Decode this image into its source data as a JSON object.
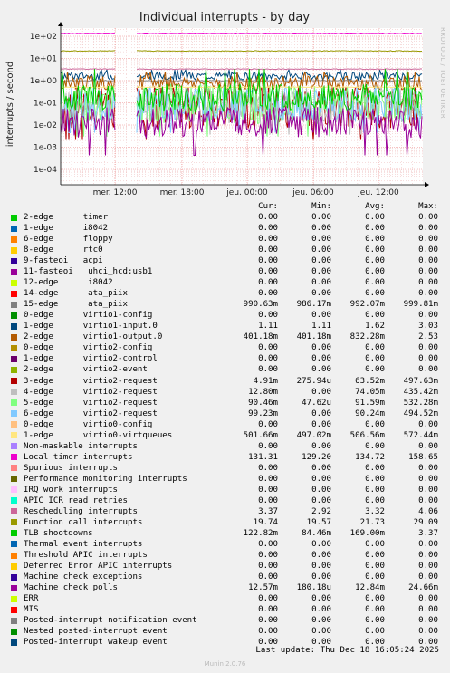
{
  "chart_data": {
    "type": "line",
    "title": "Individual interrupts - by day",
    "ylabel": "interrupts / second",
    "xlabel": "",
    "y_scale": "log",
    "ylim": [
      2e-05,
      300
    ],
    "y_ticks": [
      "1e+02",
      "1e+01",
      "1e+00",
      "1e-01",
      "1e-02",
      "1e-03",
      "1e-04"
    ],
    "x_ticks": [
      "mer. 12:00",
      "mer. 18:00",
      "jeu. 00:00",
      "jeu. 06:00",
      "jeu. 12:00"
    ],
    "grid": true,
    "side_label": "RRDTOOL / TOBI OETIKER",
    "data_gap": "around mer. 13:00",
    "legend_header": [
      "Cur:",
      "Min:",
      "Avg:",
      "Max:"
    ],
    "series": [
      {
        "name": "2-edge      timer",
        "color": "#00cc00",
        "cur": "0.00",
        "min": "0.00",
        "avg": "0.00",
        "max": "0.00"
      },
      {
        "name": "1-edge      i8042",
        "color": "#0066b3",
        "cur": "0.00",
        "min": "0.00",
        "avg": "0.00",
        "max": "0.00"
      },
      {
        "name": "6-edge      floppy",
        "color": "#ff8000",
        "cur": "0.00",
        "min": "0.00",
        "avg": "0.00",
        "max": "0.00"
      },
      {
        "name": "8-edge      rtc0",
        "color": "#ffcc00",
        "cur": "0.00",
        "min": "0.00",
        "avg": "0.00",
        "max": "0.00"
      },
      {
        "name": "9-fasteoi   acpi",
        "color": "#330099",
        "cur": "0.00",
        "min": "0.00",
        "avg": "0.00",
        "max": "0.00"
      },
      {
        "name": "11-fasteoi   uhci_hcd:usb1",
        "color": "#990099",
        "cur": "0.00",
        "min": "0.00",
        "avg": "0.00",
        "max": "0.00"
      },
      {
        "name": "12-edge      i8042",
        "color": "#ccff00",
        "cur": "0.00",
        "min": "0.00",
        "avg": "0.00",
        "max": "0.00"
      },
      {
        "name": "14-edge      ata_piix",
        "color": "#ff0000",
        "cur": "0.00",
        "min": "0.00",
        "avg": "0.00",
        "max": "0.00"
      },
      {
        "name": "15-edge      ata_piix",
        "color": "#808080",
        "cur": "990.63m",
        "min": "986.17m",
        "avg": "992.07m",
        "max": "999.81m"
      },
      {
        "name": "0-edge      virtio1-config",
        "color": "#008f00",
        "cur": "0.00",
        "min": "0.00",
        "avg": "0.00",
        "max": "0.00"
      },
      {
        "name": "1-edge      virtio1-input.0",
        "color": "#00487d",
        "cur": "1.11",
        "min": "1.11",
        "avg": "1.62",
        "max": "3.03"
      },
      {
        "name": "2-edge      virtio1-output.0",
        "color": "#b35a00",
        "cur": "401.18m",
        "min": "401.18m",
        "avg": "832.28m",
        "max": "2.53"
      },
      {
        "name": "0-edge      virtio2-config",
        "color": "#b38f00",
        "cur": "0.00",
        "min": "0.00",
        "avg": "0.00",
        "max": "0.00"
      },
      {
        "name": "1-edge      virtio2-control",
        "color": "#6b006b",
        "cur": "0.00",
        "min": "0.00",
        "avg": "0.00",
        "max": "0.00"
      },
      {
        "name": "2-edge      virtio2-event",
        "color": "#8fb300",
        "cur": "0.00",
        "min": "0.00",
        "avg": "0.00",
        "max": "0.00"
      },
      {
        "name": "3-edge      virtio2-request",
        "color": "#b30000",
        "cur": "4.91m",
        "min": "275.94u",
        "avg": "63.52m",
        "max": "497.63m"
      },
      {
        "name": "4-edge      virtio2-request",
        "color": "#bebebe",
        "cur": "12.80m",
        "min": "0.00",
        "avg": "74.05m",
        "max": "435.42m"
      },
      {
        "name": "5-edge      virtio2-request",
        "color": "#80ff80",
        "cur": "90.46m",
        "min": "47.62u",
        "avg": "91.59m",
        "max": "532.28m"
      },
      {
        "name": "6-edge      virtio2-request",
        "color": "#80c9ff",
        "cur": "99.23m",
        "min": "0.00",
        "avg": "90.24m",
        "max": "494.52m"
      },
      {
        "name": "0-edge      virtio0-config",
        "color": "#ffc080",
        "cur": "0.00",
        "min": "0.00",
        "avg": "0.00",
        "max": "0.00"
      },
      {
        "name": "1-edge      virtio0-virtqueues",
        "color": "#ffe680",
        "cur": "501.66m",
        "min": "497.02m",
        "avg": "506.56m",
        "max": "572.44m"
      },
      {
        "name": "Non-maskable interrupts",
        "color": "#aa80ff",
        "cur": "0.00",
        "min": "0.00",
        "avg": "0.00",
        "max": "0.00"
      },
      {
        "name": "Local timer interrupts",
        "color": "#ee00cc",
        "cur": "131.31",
        "min": "129.20",
        "avg": "134.72",
        "max": "158.65"
      },
      {
        "name": "Spurious interrupts",
        "color": "#ff8080",
        "cur": "0.00",
        "min": "0.00",
        "avg": "0.00",
        "max": "0.00"
      },
      {
        "name": "Performance monitoring interrupts",
        "color": "#666600",
        "cur": "0.00",
        "min": "0.00",
        "avg": "0.00",
        "max": "0.00"
      },
      {
        "name": "IRQ work interrupts",
        "color": "#ffbfff",
        "cur": "0.00",
        "min": "0.00",
        "avg": "0.00",
        "max": "0.00"
      },
      {
        "name": "APIC ICR read retries",
        "color": "#00ffcc",
        "cur": "0.00",
        "min": "0.00",
        "avg": "0.00",
        "max": "0.00"
      },
      {
        "name": "Rescheduling interrupts",
        "color": "#cc6699",
        "cur": "3.37",
        "min": "2.92",
        "avg": "3.32",
        "max": "4.06"
      },
      {
        "name": "Function call interrupts",
        "color": "#999900",
        "cur": "19.74",
        "min": "19.57",
        "avg": "21.73",
        "max": "29.09"
      },
      {
        "name": "TLB shootdowns",
        "color": "#00cc00",
        "cur": "122.82m",
        "min": "84.46m",
        "avg": "169.00m",
        "max": "3.37"
      },
      {
        "name": "Thermal event interrupts",
        "color": "#0066b3",
        "cur": "0.00",
        "min": "0.00",
        "avg": "0.00",
        "max": "0.00"
      },
      {
        "name": "Threshold APIC interrupts",
        "color": "#ff8000",
        "cur": "0.00",
        "min": "0.00",
        "avg": "0.00",
        "max": "0.00"
      },
      {
        "name": "Deferred Error APIC interrupts",
        "color": "#ffcc00",
        "cur": "0.00",
        "min": "0.00",
        "avg": "0.00",
        "max": "0.00"
      },
      {
        "name": "Machine check exceptions",
        "color": "#330099",
        "cur": "0.00",
        "min": "0.00",
        "avg": "0.00",
        "max": "0.00"
      },
      {
        "name": "Machine check polls",
        "color": "#990099",
        "cur": "12.57m",
        "min": "180.18u",
        "avg": "12.84m",
        "max": "24.66m"
      },
      {
        "name": "ERR",
        "color": "#ccff00",
        "cur": "0.00",
        "min": "0.00",
        "avg": "0.00",
        "max": "0.00"
      },
      {
        "name": "MIS",
        "color": "#ff0000",
        "cur": "0.00",
        "min": "0.00",
        "avg": "0.00",
        "max": "0.00"
      },
      {
        "name": "Posted-interrupt notification event",
        "color": "#808080",
        "cur": "0.00",
        "min": "0.00",
        "avg": "0.00",
        "max": "0.00"
      },
      {
        "name": "Nested posted-interrupt event",
        "color": "#008f00",
        "cur": "0.00",
        "min": "0.00",
        "avg": "0.00",
        "max": "0.00"
      },
      {
        "name": "Posted-interrupt wakeup event",
        "color": "#00487d",
        "cur": "0.00",
        "min": "0.00",
        "avg": "0.00",
        "max": "0.00"
      }
    ]
  },
  "footer": {
    "last_update": "Last update: Thu Dec 18 16:05:24 2025",
    "generator": "Munin 2.0.76"
  }
}
